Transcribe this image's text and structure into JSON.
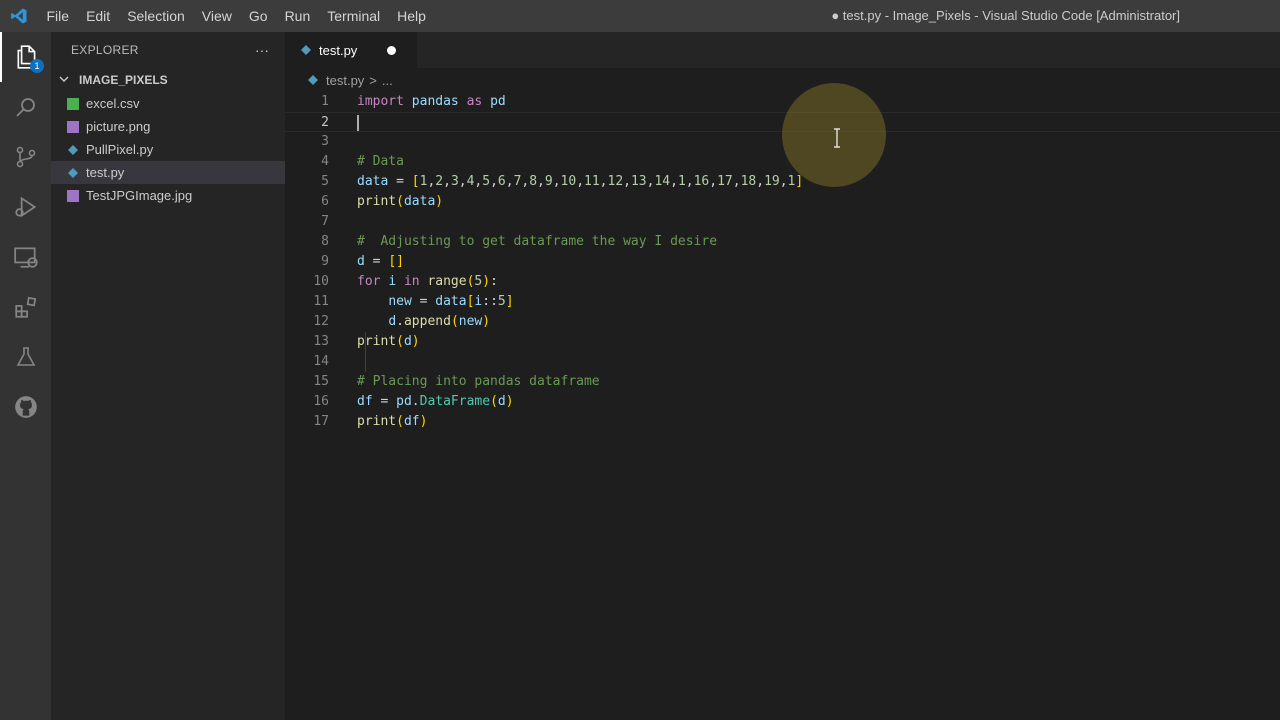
{
  "titlebar": {
    "menu": [
      "File",
      "Edit",
      "Selection",
      "View",
      "Go",
      "Run",
      "Terminal",
      "Help"
    ],
    "window_title": "● test.py - Image_Pixels - Visual Studio Code [Administrator]"
  },
  "activity_bar": {
    "items": [
      "explorer-icon",
      "search-icon",
      "source-control-icon",
      "run-debug-icon",
      "remote-explorer-icon",
      "extensions-icon",
      "testing-icon",
      "github-icon"
    ],
    "explorer_badge": "1"
  },
  "sidebar": {
    "title": "EXPLORER",
    "more": "···",
    "folder": "IMAGE_PIXELS",
    "files": [
      {
        "name": "excel.csv",
        "icon": "csv-file-icon"
      },
      {
        "name": "picture.png",
        "icon": "image-file-icon"
      },
      {
        "name": "PullPixel.py",
        "icon": "python-file-icon"
      },
      {
        "name": "test.py",
        "icon": "python-file-icon",
        "selected": true
      },
      {
        "name": "TestJPGImage.jpg",
        "icon": "image-file-icon"
      }
    ]
  },
  "editor": {
    "tab_label": "test.py",
    "breadcrumb_file": "test.py",
    "breadcrumb_sep": ">",
    "breadcrumb_more": "...",
    "lines": [
      {
        "n": "1",
        "code": "import pandas as pd"
      },
      {
        "n": "2",
        "code": ""
      },
      {
        "n": "3",
        "code": ""
      },
      {
        "n": "4",
        "code": "# Data"
      },
      {
        "n": "5",
        "code": "data = [1,2,3,4,5,6,7,8,9,10,11,12,13,14,1,16,17,18,19,1]"
      },
      {
        "n": "6",
        "code": "print(data)"
      },
      {
        "n": "7",
        "code": ""
      },
      {
        "n": "8",
        "code": "#  Adjusting to get dataframe the way I desire"
      },
      {
        "n": "9",
        "code": "d = []"
      },
      {
        "n": "10",
        "code": "for i in range(5):"
      },
      {
        "n": "11",
        "code": "    new = data[i::5]"
      },
      {
        "n": "12",
        "code": "    d.append(new)"
      },
      {
        "n": "13",
        "code": "print(d)"
      },
      {
        "n": "14",
        "code": ""
      },
      {
        "n": "15",
        "code": "# Placing into pandas dataframe"
      },
      {
        "n": "16",
        "code": "df = pd.DataFrame(d)"
      },
      {
        "n": "17",
        "code": "print(df)"
      }
    ]
  },
  "colors": {
    "keyword": "#c586c0",
    "function": "#dcdcaa",
    "variable": "#9cdcfe",
    "number": "#b5cea8",
    "comment": "#6a9955",
    "class": "#4ec9b0",
    "bracket": "#ffd700"
  }
}
